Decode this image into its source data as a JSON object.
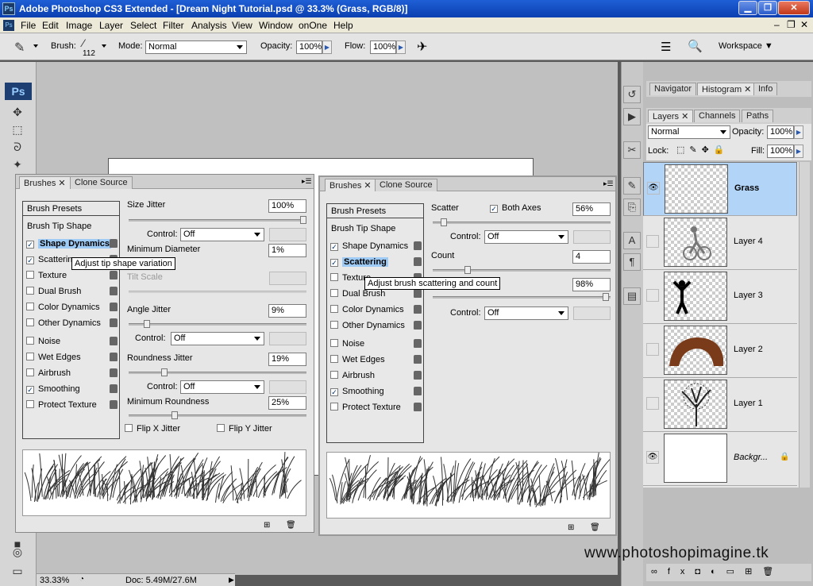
{
  "titlebar": {
    "app_icon": "Ps",
    "title": "Adobe Photoshop CS3 Extended - [Dream Night Tutorial.psd @ 33.3% (Grass, RGB/8)]"
  },
  "menu": [
    "File",
    "Edit",
    "Image",
    "Layer",
    "Select",
    "Filter",
    "Analysis",
    "View",
    "Window",
    "onOne",
    "Help"
  ],
  "options": {
    "brush_label": "Brush:",
    "brush_size": "112",
    "mode_label": "Mode:",
    "mode_value": "Normal",
    "opacity_label": "Opacity:",
    "opacity_value": "100%",
    "flow_label": "Flow:",
    "flow_value": "100%",
    "workspace_label": "Workspace"
  },
  "toolbox": {
    "logo": "Ps"
  },
  "brushes_left": {
    "tabs": [
      "Brushes",
      "Clone Source"
    ],
    "presets": "Brush Presets",
    "tip_shape": "Brush Tip Shape",
    "items": [
      {
        "label": "Shape Dynamics",
        "checked": true,
        "highlight": true
      },
      {
        "label": "Scattering",
        "checked": true,
        "highlight": false
      },
      {
        "label": "Texture",
        "checked": false,
        "highlight": false
      },
      {
        "label": "Dual Brush",
        "checked": false,
        "highlight": false
      },
      {
        "label": "Color Dynamics",
        "checked": false,
        "highlight": false
      },
      {
        "label": "Other Dynamics",
        "checked": false,
        "highlight": false
      },
      {
        "label": "Noise",
        "checked": false,
        "highlight": false
      },
      {
        "label": "Wet Edges",
        "checked": false,
        "highlight": false
      },
      {
        "label": "Airbrush",
        "checked": false,
        "highlight": false
      },
      {
        "label": "Smoothing",
        "checked": true,
        "highlight": false
      },
      {
        "label": "Protect Texture",
        "checked": false,
        "highlight": false
      }
    ],
    "tooltip": "Adjust tip shape variation",
    "size_jitter_label": "Size Jitter",
    "size_jitter_value": "100%",
    "size_jitter_level": 1.0,
    "control_label": "Control:",
    "control_value": "Off",
    "min_diameter_label": "Minimum Diameter",
    "min_diameter_value": "1%",
    "tilt_scale_label": "Tilt Scale",
    "angle_jitter_label": "Angle Jitter",
    "angle_jitter_value": "9%",
    "angle_jitter_level": 0.09,
    "roundness_jitter_label": "Roundness Jitter",
    "roundness_jitter_value": "19%",
    "roundness_jitter_level": 0.19,
    "min_roundness_label": "Minimum Roundness",
    "min_roundness_value": "25%",
    "min_roundness_level": 0.25,
    "flip_x": "Flip X Jitter",
    "flip_y": "Flip Y Jitter"
  },
  "brushes_right": {
    "tabs": [
      "Brushes",
      "Clone Source"
    ],
    "presets": "Brush Presets",
    "tip_shape": "Brush Tip Shape",
    "items": [
      {
        "label": "Shape Dynamics",
        "checked": true,
        "highlight": false
      },
      {
        "label": "Scattering",
        "checked": true,
        "highlight": true
      },
      {
        "label": "Texture",
        "checked": false,
        "highlight": false
      },
      {
        "label": "Dual Brush",
        "checked": false,
        "highlight": false
      },
      {
        "label": "Color Dynamics",
        "checked": false,
        "highlight": false
      },
      {
        "label": "Other Dynamics",
        "checked": false,
        "highlight": false
      },
      {
        "label": "Noise",
        "checked": false,
        "highlight": false
      },
      {
        "label": "Wet Edges",
        "checked": false,
        "highlight": false
      },
      {
        "label": "Airbrush",
        "checked": false,
        "highlight": false
      },
      {
        "label": "Smoothing",
        "checked": true,
        "highlight": false
      },
      {
        "label": "Protect Texture",
        "checked": false,
        "highlight": false
      }
    ],
    "tooltip": "Adjust brush scattering and count",
    "scatter_label": "Scatter",
    "both_axes_label": "Both Axes",
    "scatter_value": "56%",
    "control_label": "Control:",
    "control_value": "Off",
    "count_label": "Count",
    "count_value": "4",
    "count_jitter_value": "98%"
  },
  "right_panels": {
    "top_tabs": [
      "Navigator",
      "Histogram",
      "Info"
    ],
    "layer_tabs": [
      "Layers",
      "Channels",
      "Paths"
    ],
    "blend_mode": "Normal",
    "opacity_label": "Opacity:",
    "opacity_value": "100%",
    "lock_label": "Lock:",
    "fill_label": "Fill:",
    "fill_value": "100%",
    "layers": [
      {
        "name": "Grass",
        "visible": true,
        "selected": true
      },
      {
        "name": "Layer 4",
        "visible": false,
        "selected": false
      },
      {
        "name": "Layer 3",
        "visible": false,
        "selected": false
      },
      {
        "name": "Layer 2",
        "visible": false,
        "selected": false
      },
      {
        "name": "Layer 1",
        "visible": false,
        "selected": false
      },
      {
        "name": "Backgr...",
        "visible": true,
        "selected": false
      }
    ]
  },
  "status": {
    "zoom": "33.33%",
    "doc": "Doc: 5.49M/27.6M"
  },
  "watermark": "www.photoshopimagine.tk"
}
